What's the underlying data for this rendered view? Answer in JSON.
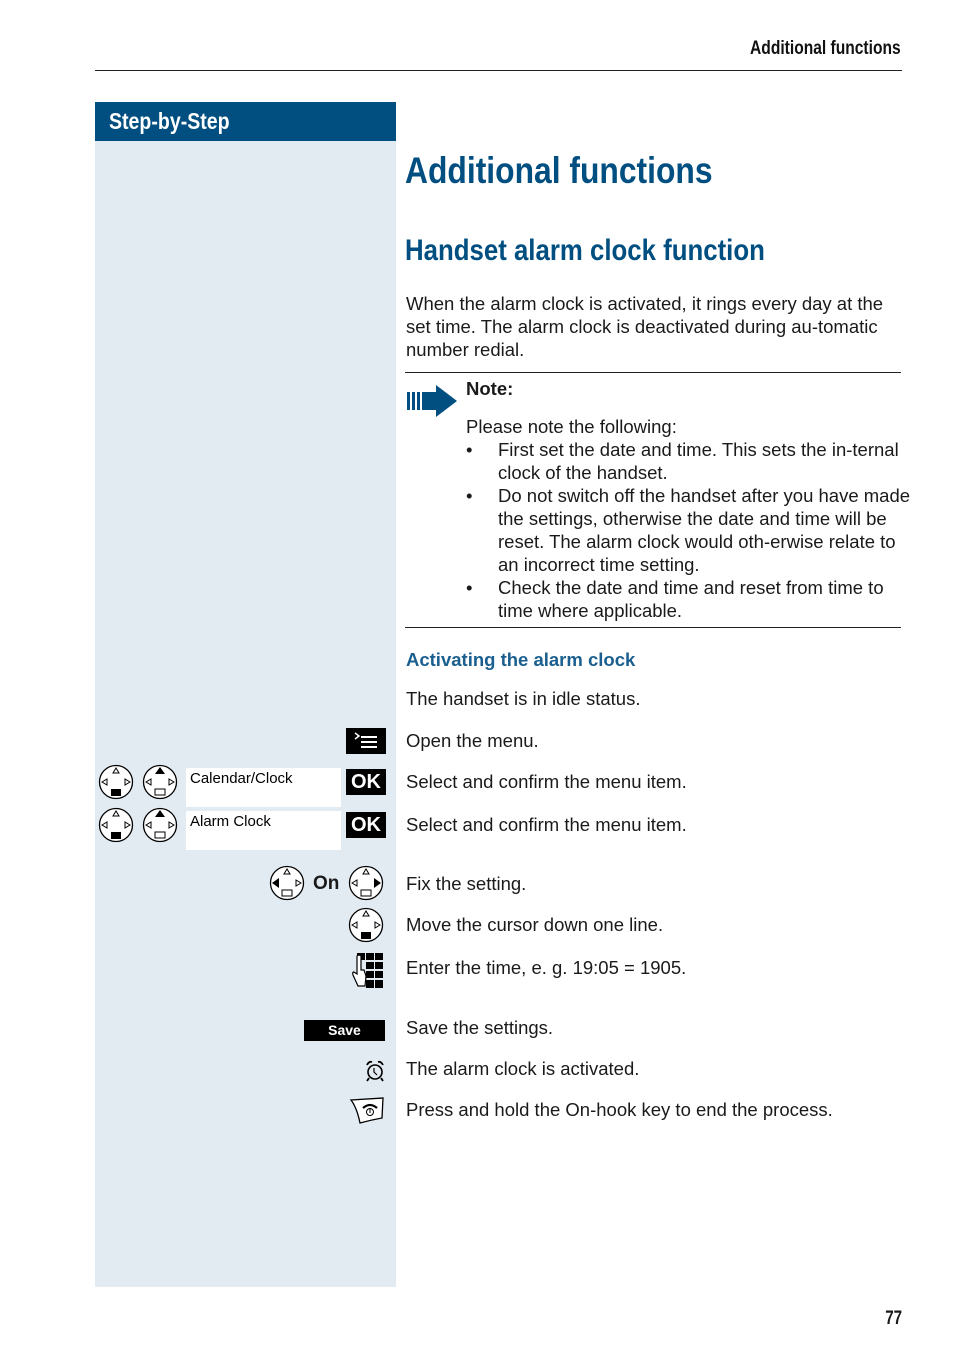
{
  "header": {
    "running_title": "Additional functions"
  },
  "sidebar": {
    "title": "Step-by-Step"
  },
  "main": {
    "title": "Additional functions",
    "section_title": "Handset alarm clock function",
    "intro": "When the alarm clock is activated, it rings every day at the set time. The alarm clock is deactivated during au-tomatic number redial.",
    "note": {
      "icon": "note-arrow-icon",
      "title": "Note:",
      "lead": "Please note the following:",
      "bullets": [
        "First set the date and time. This sets the in-ternal clock of the handset.",
        "Do not switch off the handset after you have made the settings, otherwise the date and time will be reset. The alarm clock would oth-erwise relate to an incorrect time setting.",
        "Check the date and time and reset from time to time where applicable."
      ]
    },
    "subsection_title": "Activating the alarm clock",
    "steps": [
      {
        "instruction": "The handset is in idle status."
      },
      {
        "icon": "menu-key-icon",
        "instruction": "Open the menu."
      },
      {
        "icons": [
          "control-key-down-icon",
          "control-key-up-icon"
        ],
        "display": "Calendar/Clock",
        "key": "OK",
        "instruction": "Select and confirm the menu item."
      },
      {
        "icons": [
          "control-key-down-icon",
          "control-key-up-icon"
        ],
        "display": "Alarm Clock",
        "key": "OK",
        "instruction": "Select and confirm the menu item."
      },
      {
        "icons": [
          "control-key-left-icon",
          "control-key-right-icon"
        ],
        "value": "On",
        "instruction": "Fix the setting."
      },
      {
        "icon": "control-key-down-icon",
        "instruction": "Move the cursor down one line."
      },
      {
        "icon": "keypad-icon",
        "instruction": "Enter the time, e. g. 19:05 = 1905."
      },
      {
        "softkey": "Save",
        "instruction": "Save the settings."
      },
      {
        "icon": "alarm-clock-icon",
        "instruction": "The alarm clock is activated."
      },
      {
        "icon": "on-hook-key-icon",
        "instruction": "Press and hold the On-hook key to end the process."
      }
    ]
  },
  "footer": {
    "page_number": "77"
  }
}
